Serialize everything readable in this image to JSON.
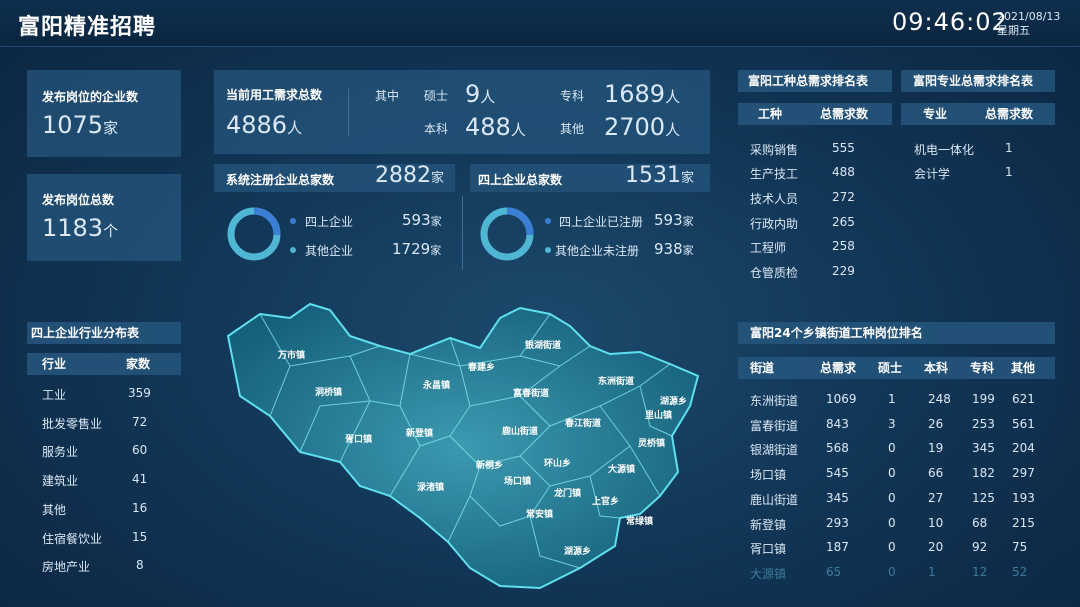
{
  "header": {
    "title": "富阳精准招聘",
    "time": "09:46:02",
    "date": "2021/08/13",
    "weekday": "星期五"
  },
  "enterprise_count": {
    "label": "发布岗位的企业数",
    "value": "1075",
    "unit": "家"
  },
  "post_count": {
    "label": "发布岗位总数",
    "value": "1183",
    "unit": "个"
  },
  "demand": {
    "label": "当前用工需求总数",
    "value": "4886",
    "unit": "人",
    "among": "其中",
    "items": [
      {
        "label": "硕士",
        "value": "9",
        "unit": "人"
      },
      {
        "label": "专科",
        "value": "1689",
        "unit": "人"
      },
      {
        "label": "本科",
        "value": "488",
        "unit": "人"
      },
      {
        "label": "其他",
        "value": "2700",
        "unit": "人"
      }
    ]
  },
  "registered": {
    "label": "系统注册企业总家数",
    "value": "2882",
    "unit": "家",
    "legend": [
      {
        "label": "四上企业",
        "value": "593",
        "unit": "家"
      },
      {
        "label": "其他企业",
        "value": "1729",
        "unit": "家"
      }
    ]
  },
  "above_scale": {
    "label": "四上企业总家数",
    "value": "1531",
    "unit": "家",
    "legend": [
      {
        "label": "四上企业已注册",
        "value": "593",
        "unit": "家"
      },
      {
        "label": "其他企业未注册",
        "value": "938",
        "unit": "家"
      }
    ]
  },
  "job_rank": {
    "title": "富阳工种总需求排名表",
    "headers": [
      "工种",
      "总需求数"
    ],
    "rows": [
      [
        "采购销售",
        "555"
      ],
      [
        "生产技工",
        "488"
      ],
      [
        "技术人员",
        "272"
      ],
      [
        "行政内助",
        "265"
      ],
      [
        "工程师",
        "258"
      ],
      [
        "仓管质检",
        "229"
      ]
    ]
  },
  "major_rank": {
    "title": "富阳专业总需求排名表",
    "headers": [
      "专业",
      "总需求数"
    ],
    "rows": [
      [
        "机电一体化",
        "1"
      ],
      [
        "会计学",
        "1"
      ]
    ]
  },
  "industry": {
    "title": "四上企业行业分布表",
    "headers": [
      "行业",
      "家数"
    ],
    "rows": [
      [
        "工业",
        "359"
      ],
      [
        "批发零售业",
        "72"
      ],
      [
        "服务业",
        "60"
      ],
      [
        "建筑业",
        "41"
      ],
      [
        "其他",
        "16"
      ],
      [
        "住宿餐饮业",
        "15"
      ],
      [
        "房地产业",
        "8"
      ]
    ]
  },
  "street_rank": {
    "title": "富阳24个乡镇街道工种岗位排名",
    "headers": [
      "街道",
      "总需求",
      "硕士",
      "本科",
      "专科",
      "其他"
    ],
    "rows": [
      [
        "东洲街道",
        "1069",
        "1",
        "248",
        "199",
        "621"
      ],
      [
        "富春街道",
        "843",
        "3",
        "26",
        "253",
        "561"
      ],
      [
        "银湖街道",
        "568",
        "0",
        "19",
        "345",
        "204"
      ],
      [
        "场口镇",
        "545",
        "0",
        "66",
        "182",
        "297"
      ],
      [
        "鹿山街道",
        "345",
        "0",
        "27",
        "125",
        "193"
      ],
      [
        "新登镇",
        "293",
        "0",
        "10",
        "68",
        "215"
      ],
      [
        "胥口镇",
        "187",
        "0",
        "20",
        "92",
        "75"
      ],
      [
        "大源镇",
        "65",
        "0",
        "1",
        "12",
        "52"
      ]
    ]
  },
  "map": {
    "towns": [
      "万市镇",
      "洞桥镇",
      "永昌镇",
      "春建乡",
      "银湖街道",
      "东洲街道",
      "富春街道",
      "胥口镇",
      "新登镇",
      "鹿山街道",
      "春江街道",
      "湖源乡",
      "里山镇",
      "灵桥镇",
      "新桐乡",
      "环山乡",
      "大源镇",
      "渌渚镇",
      "场口镇",
      "龙门镇",
      "上官乡",
      "常安镇",
      "常绿镇",
      "湖源乡"
    ]
  },
  "colors": {
    "accent": "#4fc4e0",
    "donut_main": "#3a7fd4",
    "panel": "#26567c"
  }
}
